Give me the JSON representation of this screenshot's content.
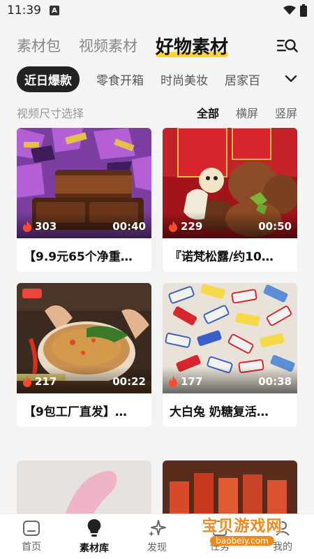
{
  "status_bar": {
    "time": "11:39",
    "badge": "A"
  },
  "top_tabs": [
    {
      "label": "素材包"
    },
    {
      "label": "视频素材"
    },
    {
      "label": "好物素材"
    }
  ],
  "category_tabs": [
    {
      "label": "近日爆款"
    },
    {
      "label": "零食开箱"
    },
    {
      "label": "时尚美妆"
    },
    {
      "label": "居家百"
    }
  ],
  "size_filter": {
    "label": "视频尺寸选择",
    "options": [
      "全部",
      "横屏",
      "竖屏"
    ],
    "selected": "全部"
  },
  "cards": [
    {
      "views": "303",
      "duration": "00:40",
      "title": "【9.9元65个净重…"
    },
    {
      "views": "229",
      "duration": "00:50",
      "title": "『诺梵松露/约10…"
    },
    {
      "views": "217",
      "duration": "00:22",
      "title": "【9包工厂直发】…"
    },
    {
      "views": "177",
      "duration": "00:38",
      "title": "大白兔 奶糖复活…"
    }
  ],
  "bottom_nav": [
    {
      "label": "首页",
      "icon": "home-icon"
    },
    {
      "label": "素材库",
      "icon": "bulb-icon"
    },
    {
      "label": "发现",
      "icon": "sparkle-icon"
    },
    {
      "label": "任务",
      "icon": "task-icon"
    },
    {
      "label": "我的",
      "icon": "profile-icon"
    }
  ],
  "watermark": {
    "title": "宝贝游戏网",
    "url": "baobeiy.com"
  },
  "colors": {
    "accent": "#ffd23a",
    "active_chip": "#222222",
    "flame": "#ff4a2d"
  }
}
